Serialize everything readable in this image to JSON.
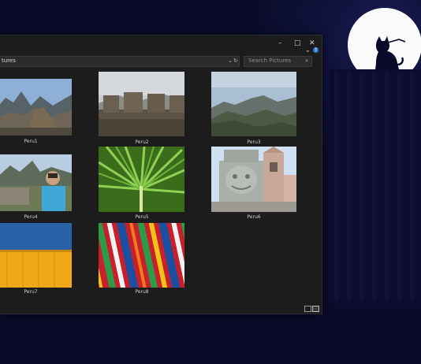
{
  "desktop": {
    "moon_color": "#fafafa"
  },
  "window": {
    "controls": {
      "minimize": "–",
      "maximize": "□",
      "close": "✕",
      "expand": "⌄",
      "help": "?"
    },
    "address": {
      "path": "tures",
      "dropdown": "⌄",
      "refresh": "↻"
    },
    "search": {
      "placeholder": "Search Pictures",
      "icon": "⌕"
    },
    "files": [
      {
        "caption": "Peru1"
      },
      {
        "caption": "Peru2"
      },
      {
        "caption": "Peru3"
      },
      {
        "caption": "Peru4"
      },
      {
        "caption": "Peru5"
      },
      {
        "caption": "Peru6"
      },
      {
        "caption": "Peru7"
      },
      {
        "caption": "Peru8"
      }
    ]
  }
}
